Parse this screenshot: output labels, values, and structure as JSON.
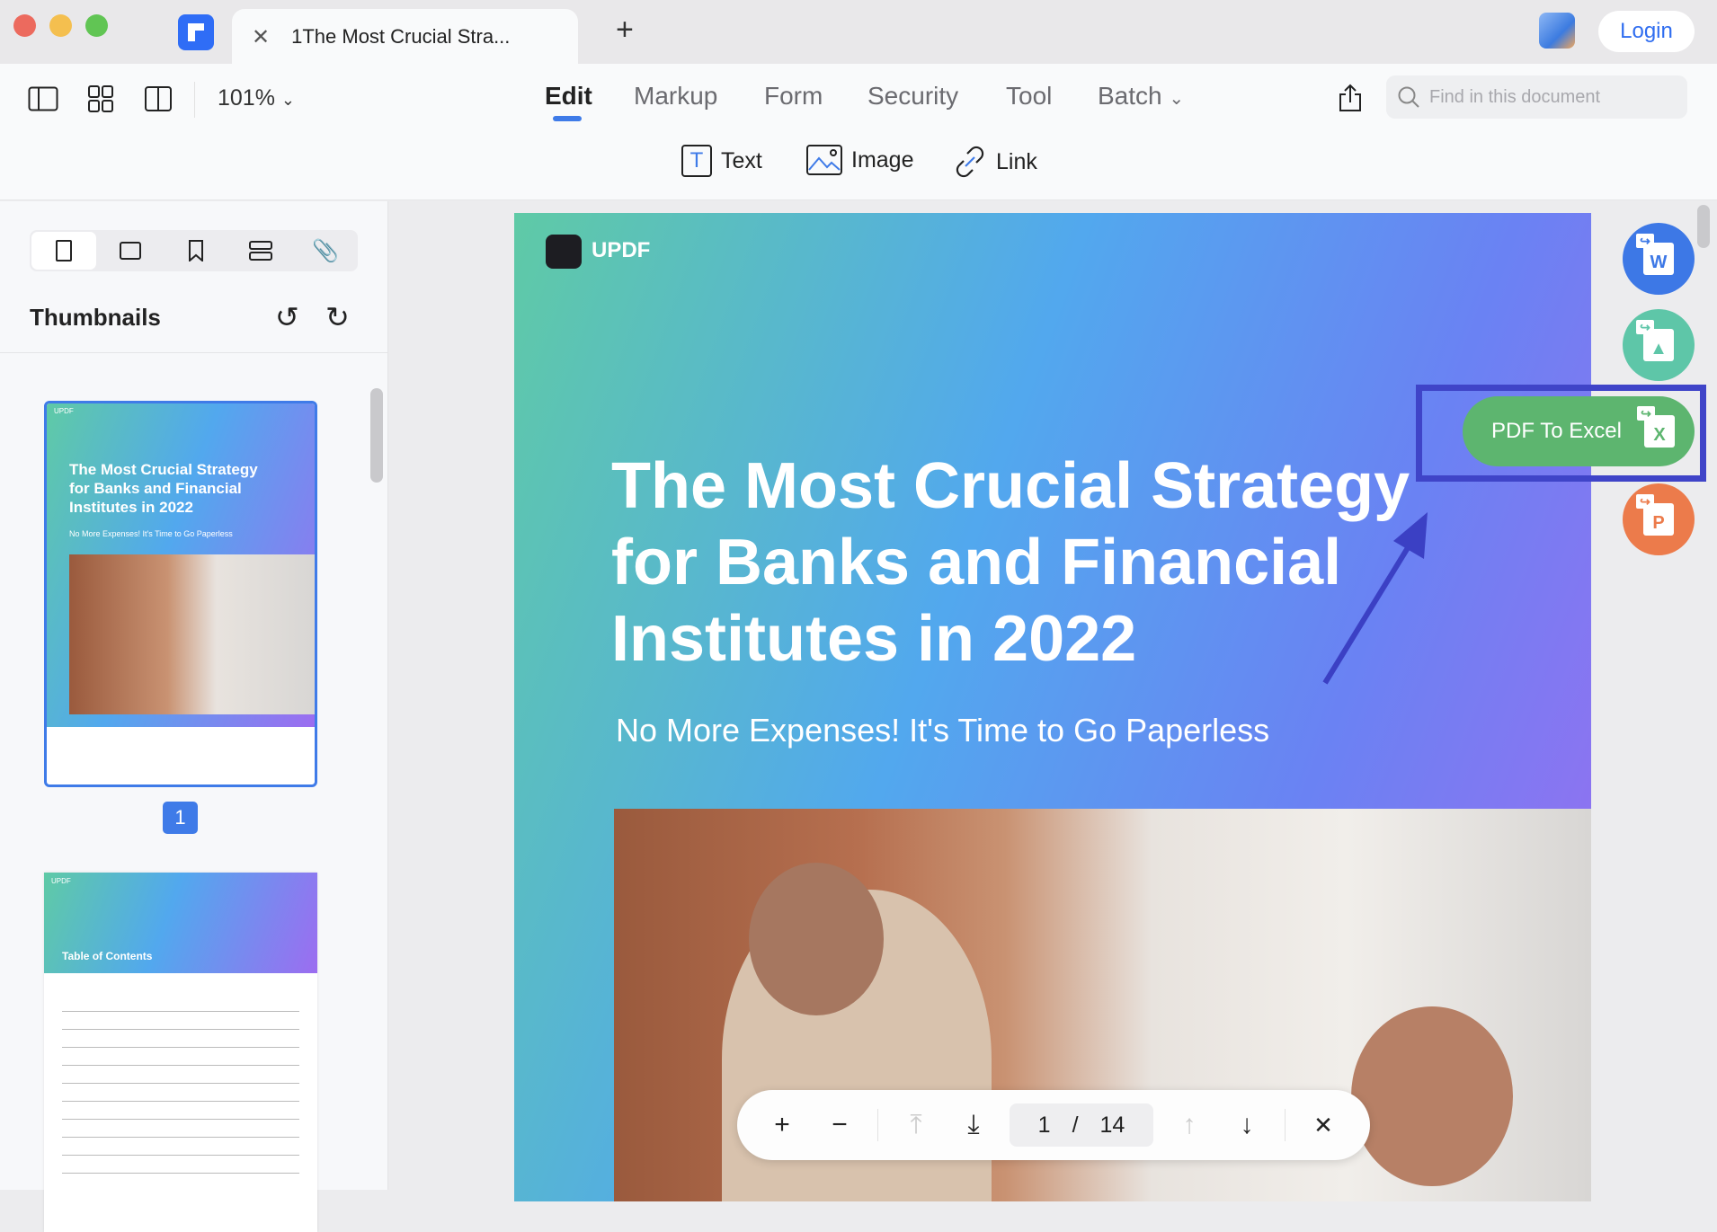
{
  "window": {
    "tab_title": "1The Most Crucial Stra...",
    "login": "Login"
  },
  "toolbar": {
    "zoom": "101%",
    "tabs": [
      "Edit",
      "Markup",
      "Form",
      "Security",
      "Tool",
      "Batch"
    ],
    "active_tab": "Edit",
    "edit_tools": [
      "Text",
      "Image",
      "Link"
    ],
    "search_placeholder": "Find in this document"
  },
  "sidebar": {
    "title": "Thumbnails",
    "current_page_badge": "1",
    "thumb1": {
      "brand": "UPDF",
      "title": "The Most Crucial Strategy for Banks and Financial Institutes in 2022",
      "subtitle": "No More Expenses! It's Time to Go Paperless"
    },
    "thumb2": {
      "brand": "UPDF",
      "title": "Table of Contents"
    }
  },
  "document": {
    "brand": "UPDF",
    "title_lines": [
      "The Most Crucial Strategy",
      "for Banks and Financial",
      "Institutes in 2022"
    ],
    "subtitle": "No More Expenses! It's Time to Go Paperless"
  },
  "convert": {
    "word_letter": "W",
    "excel_label": "PDF To Excel",
    "excel_letter": "X",
    "ppt_letter": "P",
    "colors": {
      "word": "#3d78e6",
      "image": "#5ec6a8",
      "excel": "#5db56f",
      "ppt": "#ec7b4b",
      "highlight": "#3f44c8"
    }
  },
  "pager": {
    "current": "1",
    "separator": "/",
    "total": "14"
  }
}
